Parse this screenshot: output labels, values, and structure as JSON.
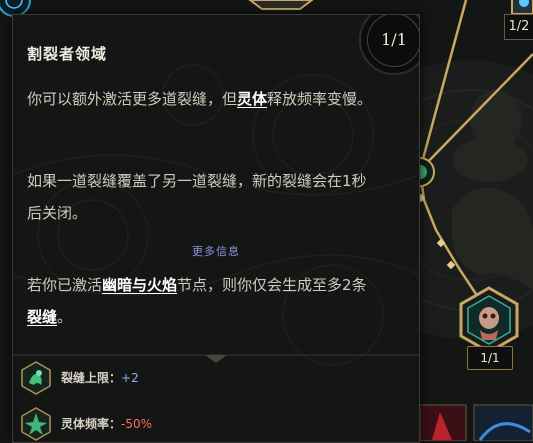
{
  "tooltip": {
    "title": "割裂者领域",
    "rank": "1/1",
    "paragraph1": {
      "before": "你可以额外激活更多道裂缝，但",
      "keyword": "灵体",
      "after": "释放频率变慢。"
    },
    "paragraph2": "如果一道裂缝覆盖了另一道裂缝，新的裂缝会在1秒后关闭。",
    "more_info": "更多信息",
    "paragraph3": {
      "before": "若你已激活",
      "keyword1": "幽暗与火焰",
      "middle": "节点，则你仅会生成至多2条",
      "keyword2": "裂缝",
      "after": "。"
    },
    "stats": [
      {
        "label": "裂缝上限：",
        "value": "+2",
        "icon": "rift-cap-icon",
        "color": "#8eb0ff"
      },
      {
        "label": "灵体频率：",
        "value": "-50%",
        "icon": "spirit-frequency-icon",
        "color": "#ff6e58"
      }
    ]
  },
  "background": {
    "corner_rank": "1/2",
    "node_rank": "1/1"
  },
  "colors": {
    "gold": "#c9a860",
    "keyword": "#ffffff",
    "more_info": "#8e97d8",
    "positive": "#8eb0ff",
    "negative": "#ff6e58"
  }
}
